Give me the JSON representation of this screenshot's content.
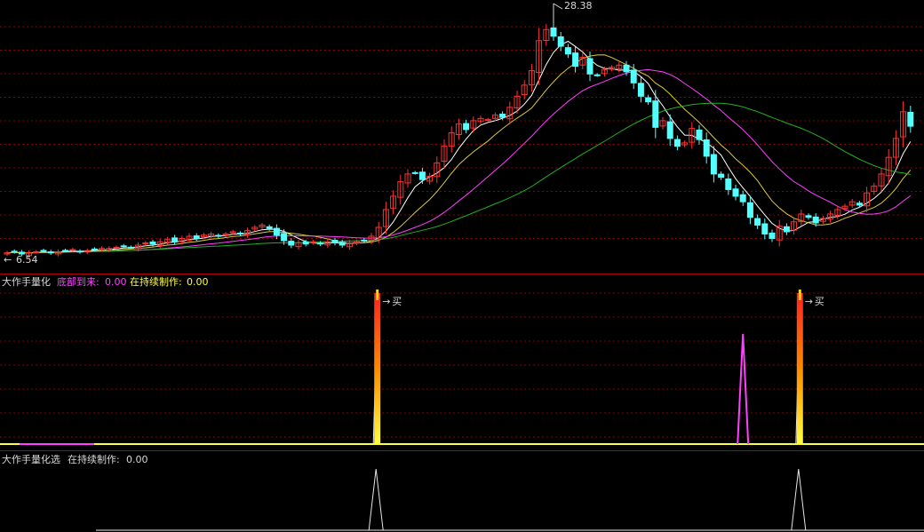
{
  "colors": {
    "background": "#000000",
    "grid": "#8b0000",
    "separator": "#b00000",
    "up_candle": "#ff3232",
    "down_candle": "#54ffff",
    "ma5": "#ffffff",
    "ma10": "#d9c93a",
    "ma20": "#ff40ff",
    "ma60": "#22b022",
    "text_white": "#d8d8d8",
    "text_magenta": "#ff40ff",
    "text_yellow": "#ffff40",
    "signal_bar": "#ff8a00",
    "signal_spike": "#e8e8e8",
    "baseline": "#ffff40"
  },
  "panels": {
    "price": {
      "high_label": "28.38",
      "low_label": "6.54"
    },
    "ind1": {
      "name": "大作手量化",
      "field1_label": "底部到来:",
      "field1_value": "0.00",
      "field2_label": "在持续制作:",
      "field2_value": "0.00",
      "buy_label": "买"
    },
    "ind2": {
      "name": "大作手量化选",
      "field1_label": "在持续制作:",
      "field1_value": "0.00"
    }
  },
  "chart_data": [
    {
      "type": "candlestick",
      "ylim": [
        5.2,
        29.5
      ],
      "grid": true,
      "series": [
        {
          "name": "MA5",
          "color": "#ffffff"
        },
        {
          "name": "MA10",
          "color": "#d9c93a"
        },
        {
          "name": "MA20",
          "color": "#ff40ff"
        },
        {
          "name": "MA60",
          "color": "#22b022"
        }
      ],
      "highest_marked": 28.38,
      "lowest_marked": 6.54,
      "closes": [
        6.9,
        7.0,
        6.8,
        6.9,
        7.0,
        7.1,
        6.9,
        7.0,
        7.1,
        7.2,
        7.0,
        7.1,
        7.2,
        7.3,
        7.3,
        7.4,
        7.5,
        7.4,
        7.6,
        7.8,
        7.7,
        7.9,
        8.1,
        7.9,
        8.2,
        8.4,
        8.2,
        8.5,
        8.6,
        8.4,
        8.6,
        8.8,
        8.6,
        8.9,
        9.2,
        9.4,
        9.1,
        8.5,
        8.0,
        7.6,
        7.8,
        7.7,
        7.9,
        7.7,
        7.9,
        7.8,
        7.6,
        7.8,
        7.9,
        8.0,
        8.4,
        9.2,
        10.8,
        12.0,
        13.3,
        14.0,
        14.1,
        13.5,
        13.8,
        15.0,
        16.5,
        17.7,
        18.5,
        18.0,
        18.8,
        19.0,
        18.9,
        19.3,
        19.1,
        20.0,
        21.0,
        22.0,
        23.3,
        26.0,
        27.0,
        26.4,
        25.5,
        24.8,
        23.7,
        24.5,
        23.0,
        22.9,
        23.4,
        23.6,
        23.8,
        23.2,
        22.2,
        21.0,
        20.5,
        18.2,
        18.8,
        17.2,
        16.5,
        16.8,
        18.1,
        17.1,
        15.6,
        14.0,
        13.7,
        12.6,
        12.0,
        11.5,
        10.1,
        9.4,
        8.6,
        8.2,
        9.3,
        8.8,
        9.7,
        10.4,
        10.1,
        9.6,
        10.0,
        10.4,
        10.8,
        11.1,
        11.5,
        11.2,
        12.3,
        12.9,
        14.0,
        15.5,
        17.2,
        19.6,
        18.3
      ]
    },
    {
      "type": "area",
      "name": "大作手量化",
      "fields": [
        {
          "label": "底部到来",
          "value": 0.0
        },
        {
          "label": "在持续制作",
          "value": 0.0
        }
      ],
      "signals": [
        {
          "bar_index": 51,
          "label": "买",
          "type": "bar"
        },
        {
          "bar_index": 109,
          "label": "买",
          "type": "bar"
        },
        {
          "bar_index": 101,
          "type": "spike",
          "color": "#ff40ff"
        }
      ]
    },
    {
      "type": "line",
      "name": "大作手量化选",
      "fields": [
        {
          "label": "在持续制作",
          "value": 0.0
        }
      ],
      "spikes_at_bar_index": [
        51,
        109
      ]
    }
  ]
}
